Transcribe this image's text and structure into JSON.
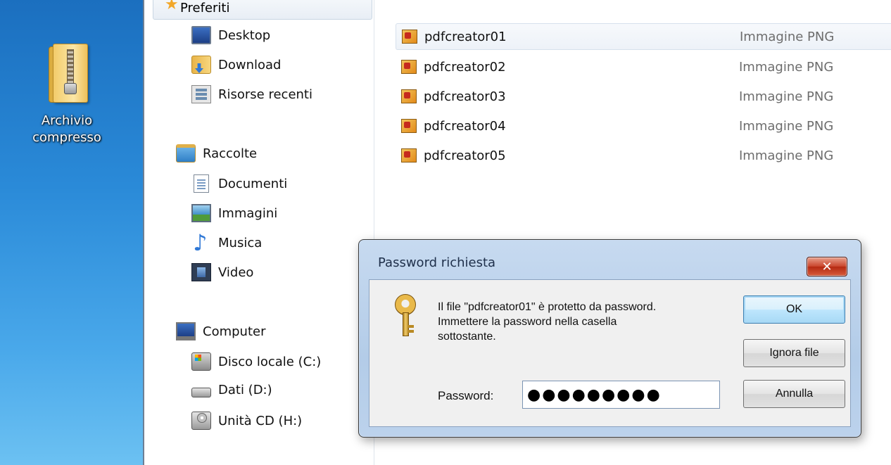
{
  "desktop": {
    "icon_label_line1": "Archivio",
    "icon_label_line2": "compresso",
    "icon": "zip-folder-icon"
  },
  "navigation": {
    "favorites_label": "Preferiti",
    "favorites": [
      {
        "label": "Desktop",
        "icon": "desktop-icon"
      },
      {
        "label": "Download",
        "icon": "download-icon"
      },
      {
        "label": "Risorse recenti",
        "icon": "recent-places-icon"
      }
    ],
    "libraries_label": "Raccolte",
    "libraries": [
      {
        "label": "Documenti",
        "icon": "documents-icon"
      },
      {
        "label": "Immagini",
        "icon": "pictures-icon"
      },
      {
        "label": "Musica",
        "icon": "music-icon"
      },
      {
        "label": "Video",
        "icon": "video-icon"
      }
    ],
    "computer_label": "Computer",
    "drives": [
      {
        "label": "Disco locale (C:)",
        "icon": "local-disk-icon"
      },
      {
        "label": "Dati (D:)",
        "icon": "drive-icon"
      },
      {
        "label": "Unità CD (H:)",
        "icon": "cd-drive-icon"
      }
    ]
  },
  "files": [
    {
      "name": "pdfcreator01",
      "type": "Immagine PNG",
      "selected": true
    },
    {
      "name": "pdfcreator02",
      "type": "Immagine PNG",
      "selected": false
    },
    {
      "name": "pdfcreator03",
      "type": "Immagine PNG",
      "selected": false
    },
    {
      "name": "pdfcreator04",
      "type": "Immagine PNG",
      "selected": false
    },
    {
      "name": "pdfcreator05",
      "type": "Immagine PNG",
      "selected": false
    }
  ],
  "dialog": {
    "title": "Password richiesta",
    "close_glyph": "✕",
    "message": "Il file \"pdfcreator01\" è protetto da password.\nImmettere la password nella casella\nsottostante.",
    "password_label": "Password:",
    "password_value": "●●●●●●●●●",
    "buttons": {
      "ok": "OK",
      "skip": "Ignora file",
      "cancel": "Annulla"
    }
  }
}
